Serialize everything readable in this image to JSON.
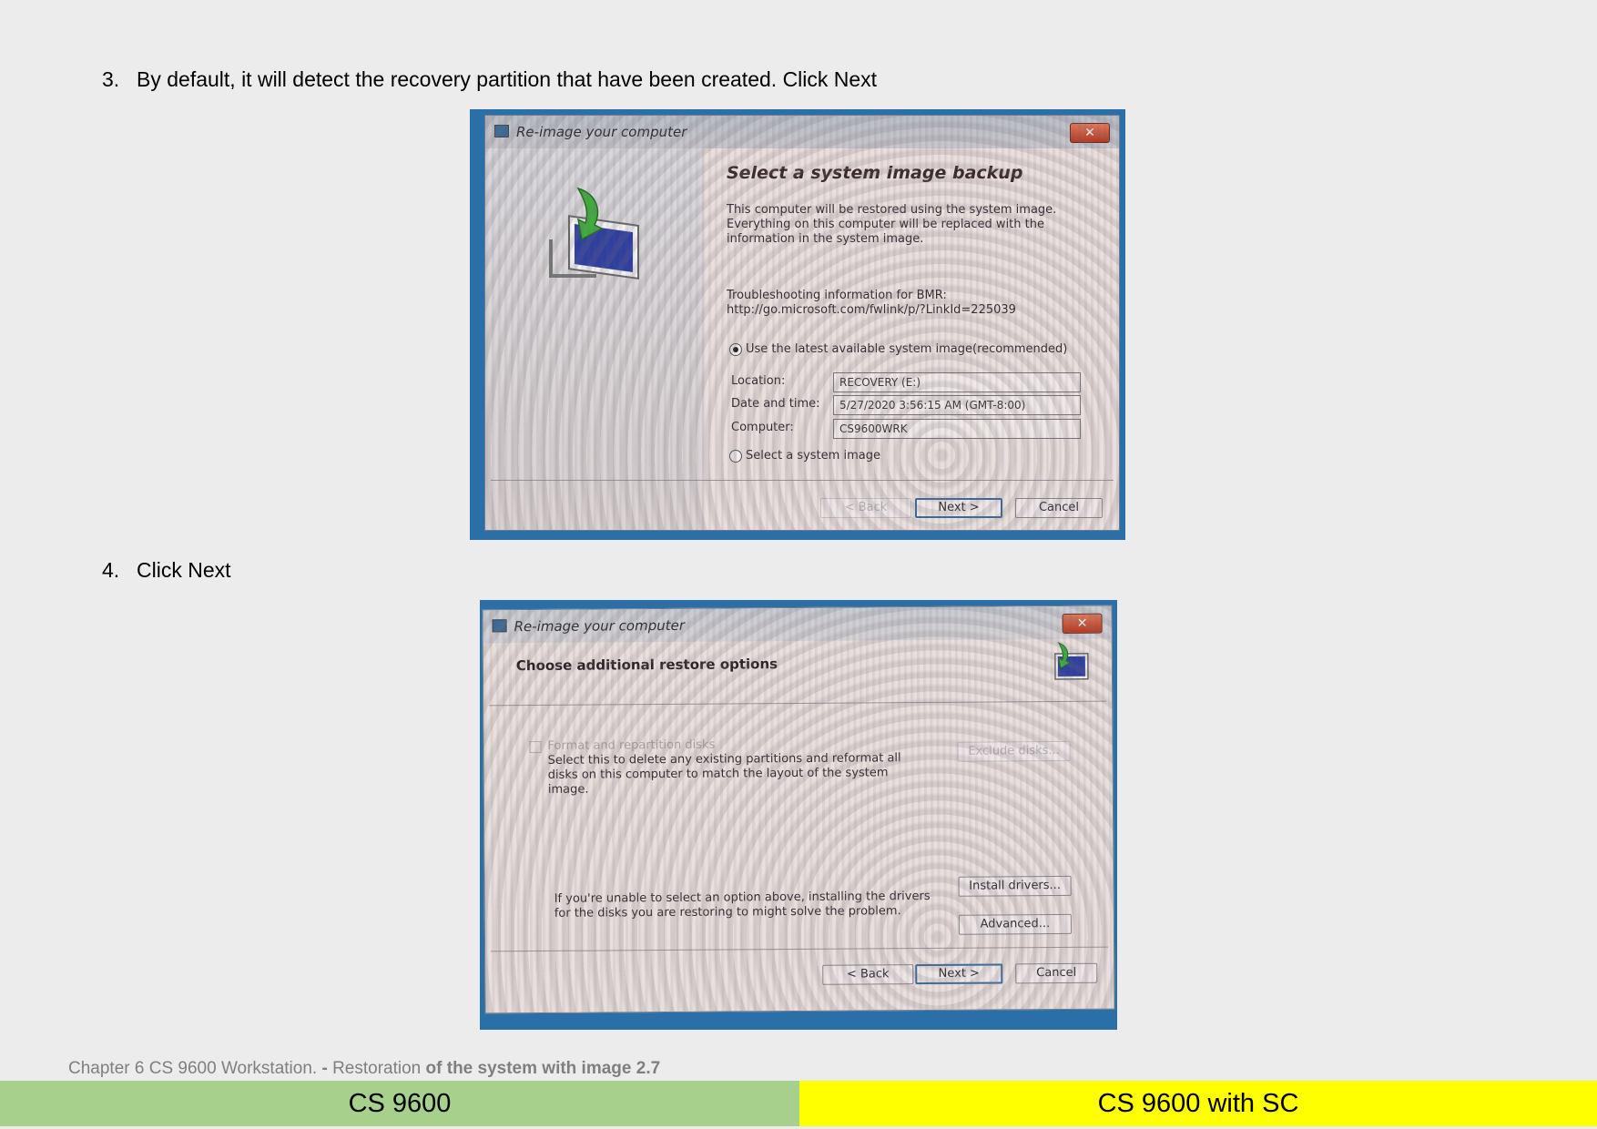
{
  "steps": [
    {
      "number": "3.",
      "text": "By default, it will detect the recovery partition that have been created. Click Next"
    },
    {
      "number": "4.",
      "text": "Click Next"
    }
  ],
  "dialog1": {
    "title": "Re-image your computer",
    "close": "✕",
    "heading": "Select a system image backup",
    "description": "This computer will be restored using the system image. Everything on this computer will be replaced with the information in the system image.",
    "troubleshooting_label": "Troubleshooting information for BMR:",
    "troubleshooting_link": "http://go.microsoft.com/fwlink/p/?LinkId=225039",
    "option_latest": "Use the latest available system image(recommended)",
    "fields": [
      {
        "label": "Location:",
        "value": "RECOVERY (E:)"
      },
      {
        "label": "Date and time:",
        "value": "5/27/2020 3:56:15 AM (GMT-8:00)"
      },
      {
        "label": "Computer:",
        "value": "CS9600WRK"
      }
    ],
    "option_select": "Select a system image",
    "buttons": {
      "back": "< Back",
      "next": "Next >",
      "cancel": "Cancel"
    }
  },
  "dialog2": {
    "title": "Re-image your computer",
    "close": "✕",
    "heading": "Choose additional restore options",
    "format_label": "Format and repartition disks",
    "format_desc": "Select this to delete any existing partitions and reformat all disks on this computer to match the layout of the system image.",
    "exclude_button": "Exclude disks...",
    "unable_text": "If you're unable to select an option above, installing the drivers for the disks you are restoring to might solve the problem.",
    "install_button": "Install drivers...",
    "advanced_button": "Advanced...",
    "buttons": {
      "back": "< Back",
      "next": "Next >",
      "cancel": "Cancel"
    }
  },
  "footer": {
    "chapter_plain": "Chapter 6 CS 9600 Workstation. ",
    "chapter_dash": "- ",
    "chapter_mid": "Restoration ",
    "chapter_bold": "of the system with image 2.7",
    "left_label": "CS 9600",
    "right_label": "CS 9600 with SC",
    "left_color": "#a8d08d",
    "right_color": "#ffff00"
  }
}
